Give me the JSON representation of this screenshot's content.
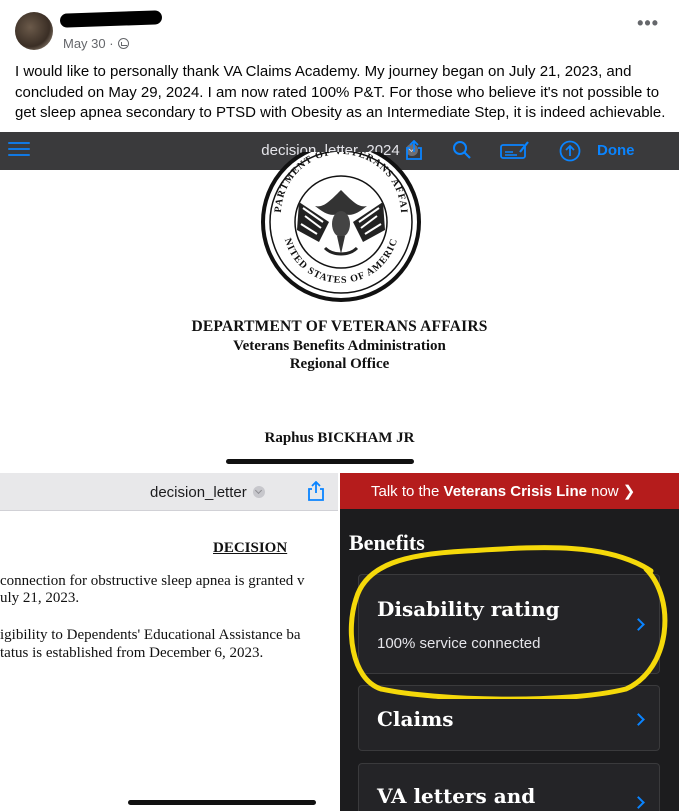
{
  "post": {
    "date": "May 30 ·",
    "more_label": "•••",
    "text": "I would like to personally thank VA Claims Academy. My journey began on July 21, 2023, and concluded on May 29, 2024. I am now rated 100% P&T. For those who believe it's not possible to get sleep apnea secondary to PTSD with Obesity as an Intermediate Step, it is indeed achievable."
  },
  "screenshot_top": {
    "doc_title": "decision_letter_2024",
    "done_label": "Done",
    "seal_text_top": "DEPARTMENT OF VETERANS AFFAIRS",
    "seal_text_bottom": "UNITED STATES OF AMERICA",
    "header_line_1": "DEPARTMENT OF VETERANS AFFAIRS",
    "header_line_2": "Veterans Benefits Administration",
    "header_line_3": "Regional Office",
    "recipient": "Raphus BICKHAM JR",
    "colors": {
      "toolbar": "#3a3a3c",
      "accent": "#0a84ff"
    }
  },
  "screenshot_left": {
    "doc_title": "decision_letter",
    "heading": "DECISION",
    "lines": [
      "connection for obstructive sleep apnea is granted v",
      "uly 21, 2023.",
      "igibility to Dependents' Educational Assistance ba",
      "tatus is established from December 6, 2023."
    ]
  },
  "screenshot_right": {
    "crisis_prefix": "Talk to the ",
    "crisis_bold": "Veterans Crisis Line",
    "crisis_suffix": " now ❯",
    "section_heading": "Benefits",
    "cards": [
      {
        "title": "Disability rating",
        "subtitle": "100% service connected"
      },
      {
        "title": "Claims"
      },
      {
        "title": "VA letters and"
      }
    ],
    "colors": {
      "crisis_bar": "#b51c1c",
      "background": "#1c1c1e",
      "highlight": "#f5d90a"
    }
  }
}
